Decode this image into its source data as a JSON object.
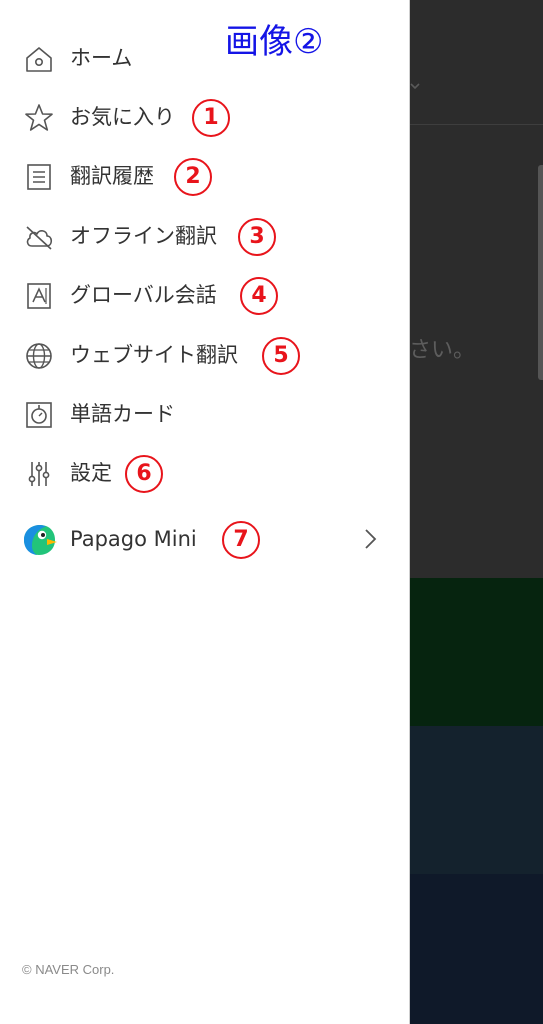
{
  "caption": "画像②",
  "menu": [
    {
      "label": "ホーム",
      "icon": "home-icon",
      "badge": ""
    },
    {
      "label": "お気に入り",
      "icon": "star-icon",
      "badge": "1"
    },
    {
      "label": "翻訳履歴",
      "icon": "history-icon",
      "badge": "2"
    },
    {
      "label": "オフライン翻訳",
      "icon": "cloud-off-icon",
      "badge": "3"
    },
    {
      "label": "グローバル会話",
      "icon": "conversation-icon",
      "badge": "4"
    },
    {
      "label": "ウェブサイト翻訳",
      "icon": "globe-icon",
      "badge": "5"
    },
    {
      "label": "単語カード",
      "icon": "word-card-icon",
      "badge": ""
    },
    {
      "label": "設定",
      "icon": "settings-sliders-icon",
      "badge": "6"
    },
    {
      "label": "Papago Mini",
      "icon": "papago-bird-icon",
      "badge": "7"
    }
  ],
  "background_peek_text": "さい。",
  "footer": "© NAVER Corp.",
  "colors": {
    "badge": "#e8141b",
    "caption": "#1414e6",
    "text": "#333333",
    "icon": "#555555"
  }
}
